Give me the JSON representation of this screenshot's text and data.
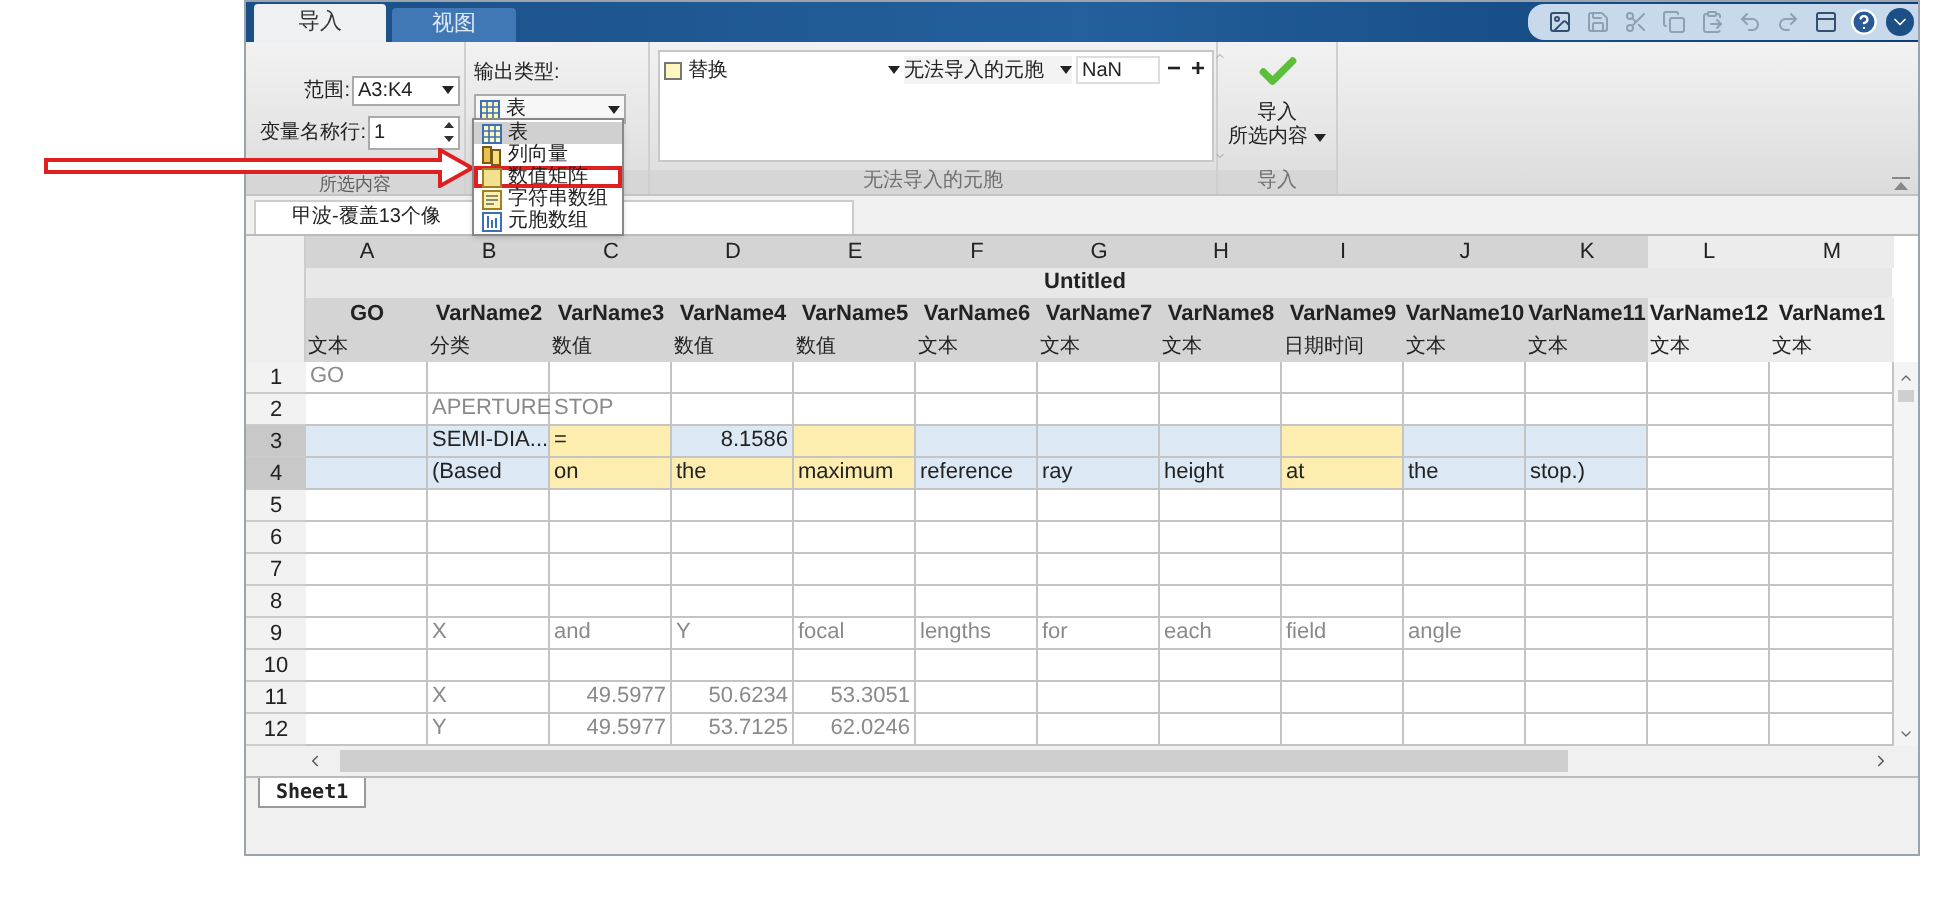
{
  "ribbon_tabs": [
    {
      "label": "导入",
      "selected": true
    },
    {
      "label": "视图",
      "selected": false
    }
  ],
  "selection": {
    "range_label": "范围:",
    "range_value": "A3:K4",
    "varname_row_label": "变量名称行:",
    "varname_row_value": "1",
    "section_label": "所选内容"
  },
  "output_type": {
    "label": "输出类型:",
    "value": "表",
    "menu_open": true,
    "menu": [
      {
        "kind": "table",
        "label": "表",
        "selected": true
      },
      {
        "kind": "column-vectors",
        "label": "列向量",
        "selected": false
      },
      {
        "kind": "matrix",
        "label": "数值矩阵",
        "selected": false,
        "highlighted": true
      },
      {
        "kind": "string-array",
        "label": "字符串数组",
        "selected": false
      },
      {
        "kind": "cell-array",
        "label": "元胞数组",
        "selected": false
      }
    ]
  },
  "unimportable": {
    "action": "替换",
    "target": "无法导入的元胞",
    "replacement": "NaN",
    "minus": "−",
    "plus": "+",
    "section_label": "无法导入的元胞"
  },
  "import": {
    "line1": "导入",
    "line2": "所选内容",
    "section_label": "导入"
  },
  "file_tab": "甲波-覆盖13个像",
  "table": {
    "title": "Untitled",
    "columns": [
      {
        "letter": "A",
        "name": "GO",
        "type": "文本",
        "in_range": true
      },
      {
        "letter": "B",
        "name": "VarName2",
        "type": "分类",
        "in_range": true
      },
      {
        "letter": "C",
        "name": "VarName3",
        "type": "数值",
        "in_range": true
      },
      {
        "letter": "D",
        "name": "VarName4",
        "type": "数值",
        "in_range": true
      },
      {
        "letter": "E",
        "name": "VarName5",
        "type": "数值",
        "in_range": true
      },
      {
        "letter": "F",
        "name": "VarName6",
        "type": "文本",
        "in_range": true
      },
      {
        "letter": "G",
        "name": "VarName7",
        "type": "文本",
        "in_range": true
      },
      {
        "letter": "H",
        "name": "VarName8",
        "type": "文本",
        "in_range": true
      },
      {
        "letter": "I",
        "name": "VarName9",
        "type": "日期时间",
        "in_range": true
      },
      {
        "letter": "J",
        "name": "VarName10",
        "type": "文本",
        "in_range": true
      },
      {
        "letter": "K",
        "name": "VarName11",
        "type": "文本",
        "in_range": true
      },
      {
        "letter": "L",
        "name": "VarName12",
        "type": "文本",
        "in_range": false
      },
      {
        "letter": "M",
        "name": "VarName1",
        "type": "文本",
        "in_range": false
      }
    ],
    "rows": [
      {
        "number": "1",
        "selected": false,
        "cells": [
          "GO",
          null,
          null,
          null,
          null,
          null,
          null,
          null,
          null,
          null,
          null,
          null,
          null
        ]
      },
      {
        "number": "2",
        "selected": false,
        "cells": [
          null,
          "APERTURE",
          "STOP",
          null,
          null,
          null,
          null,
          null,
          null,
          null,
          null,
          null,
          null
        ]
      },
      {
        "number": "3",
        "selected": true,
        "cells": [
          null,
          "SEMI-DIA...",
          "=",
          "8.1586",
          null,
          null,
          null,
          null,
          null,
          null,
          null,
          null,
          null
        ],
        "numeric": [
          false,
          false,
          false,
          true,
          false,
          false,
          false,
          false,
          false,
          false,
          false,
          false,
          false
        ],
        "flagged": [
          false,
          false,
          true,
          false,
          true,
          false,
          false,
          false,
          true,
          false,
          false,
          false,
          false
        ]
      },
      {
        "number": "4",
        "selected": true,
        "cells": [
          null,
          "(Based",
          "on",
          "the",
          "maximum",
          "reference",
          "ray",
          "height",
          "at",
          "the",
          "stop.)",
          null,
          null
        ],
        "flagged": [
          false,
          false,
          true,
          true,
          true,
          false,
          false,
          false,
          true,
          false,
          false,
          false,
          false
        ]
      },
      {
        "number": "5",
        "selected": false,
        "cells": [
          null,
          null,
          null,
          null,
          null,
          null,
          null,
          null,
          null,
          null,
          null,
          null,
          null
        ]
      },
      {
        "number": "6",
        "selected": false,
        "cells": [
          null,
          null,
          null,
          null,
          null,
          null,
          null,
          null,
          null,
          null,
          null,
          null,
          null
        ]
      },
      {
        "number": "7",
        "selected": false,
        "cells": [
          null,
          null,
          null,
          null,
          null,
          null,
          null,
          null,
          null,
          null,
          null,
          null,
          null
        ]
      },
      {
        "number": "8",
        "selected": false,
        "cells": [
          null,
          null,
          null,
          null,
          null,
          null,
          null,
          null,
          null,
          null,
          null,
          null,
          null
        ]
      },
      {
        "number": "9",
        "selected": false,
        "cells": [
          null,
          "X",
          "and",
          "Y",
          "focal",
          "lengths",
          "for",
          "each",
          "field",
          "angle",
          null,
          null,
          null
        ]
      },
      {
        "number": "10",
        "selected": false,
        "cells": [
          null,
          null,
          null,
          null,
          null,
          null,
          null,
          null,
          null,
          null,
          null,
          null,
          null
        ]
      },
      {
        "number": "11",
        "selected": false,
        "cells": [
          null,
          "X",
          "49.5977",
          "50.6234",
          "53.3051",
          null,
          null,
          null,
          null,
          null,
          null,
          null,
          null
        ],
        "numeric": [
          false,
          false,
          true,
          true,
          true,
          false,
          false,
          false,
          false,
          false,
          false,
          false,
          false
        ]
      },
      {
        "number": "12",
        "selected": false,
        "cells": [
          null,
          "Y",
          "49.5977",
          "53.7125",
          "62.0246",
          null,
          null,
          null,
          null,
          null,
          null,
          null,
          null
        ],
        "numeric": [
          false,
          false,
          true,
          true,
          true,
          false,
          false,
          false,
          false,
          false,
          false,
          false,
          false
        ]
      }
    ]
  },
  "sheet_tabs": [
    {
      "label": "Sheet1",
      "selected": true
    }
  ]
}
